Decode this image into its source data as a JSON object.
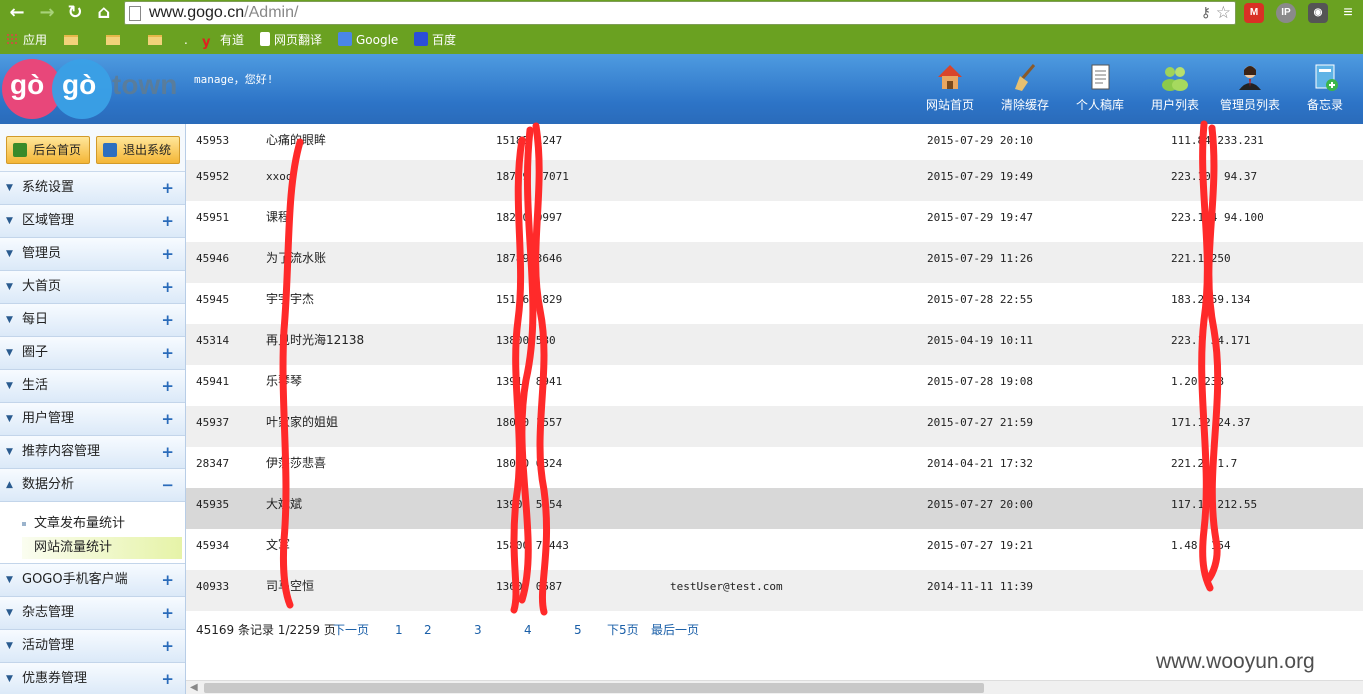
{
  "browser": {
    "url_host": "www.gogo.cn",
    "url_path": "/Admin/",
    "bookmarks": [
      {
        "label": "应用"
      },
      {
        "label": ""
      },
      {
        "label": ""
      },
      {
        "label": ""
      },
      {
        "label": "."
      },
      {
        "label": "有道"
      },
      {
        "label": "网页翻译"
      },
      {
        "label": "Google"
      },
      {
        "label": "百度"
      }
    ],
    "ext_ip": "IP"
  },
  "header": {
    "logo_a": "gò",
    "logo_b": "gò",
    "logo_c": "town",
    "greeting": "manage，您好!",
    "tools": [
      {
        "label": "网站首页"
      },
      {
        "label": "清除缓存"
      },
      {
        "label": "个人稿库"
      },
      {
        "label": "用户列表"
      },
      {
        "label": "管理员列表"
      },
      {
        "label": "备忘录"
      }
    ]
  },
  "sidebar": {
    "home_btn": "后台首页",
    "logout_btn": "退出系统",
    "items": [
      {
        "label": "系统设置",
        "sign": "+"
      },
      {
        "label": "区域管理",
        "sign": "+"
      },
      {
        "label": "管理员",
        "sign": "+"
      },
      {
        "label": "大首页",
        "sign": "+"
      },
      {
        "label": "每日",
        "sign": "+"
      },
      {
        "label": "圈子",
        "sign": "+"
      },
      {
        "label": "生活",
        "sign": "+"
      },
      {
        "label": "用户管理",
        "sign": "+"
      },
      {
        "label": "推荐内容管理",
        "sign": "+"
      },
      {
        "label": "数据分析",
        "sign": "−"
      }
    ],
    "subitems": [
      {
        "label": "文章发布量统计"
      },
      {
        "label": "网站流量统计"
      }
    ],
    "items_after": [
      {
        "label": "GOGO手机客户端",
        "sign": "+"
      },
      {
        "label": "杂志管理",
        "sign": "+"
      },
      {
        "label": "活动管理",
        "sign": "+"
      },
      {
        "label": "优惠券管理",
        "sign": "+"
      }
    ]
  },
  "table": {
    "rows": [
      {
        "id": "45953",
        "name": "心痛的眼眸",
        "phone": "15185 1247",
        "email": "",
        "time": "2015-07-29 20:10",
        "ip": "111.84 233.231"
      },
      {
        "id": "45952",
        "name": "xxoo",
        "phone": "18789 47071",
        "email": "",
        "time": "2015-07-29 19:49",
        "ip": "223.104 94.37"
      },
      {
        "id": "45951",
        "name": "课程",
        "phone": "18280 0997",
        "email": "",
        "time": "2015-07-29 19:47",
        "ip": "223.104 94.100"
      },
      {
        "id": "45946",
        "name": "为了流水账",
        "phone": "18789 3646",
        "email": "",
        "time": "2015-07-29 11:26",
        "ip": "221.1 250"
      },
      {
        "id": "45945",
        "name": "宇宇宇杰",
        "phone": "15136 5829",
        "email": "",
        "time": "2015-07-28 22:55",
        "ip": "183.2 59.134"
      },
      {
        "id": "45314",
        "name": "再见时光海12138",
        "phone": "13800 580",
        "email": "",
        "time": "2015-04-19 10:11",
        "ip": "223.1 34.171"
      },
      {
        "id": "45941",
        "name": "乐琴琴",
        "phone": "13912 8941",
        "email": "",
        "time": "2015-07-28 19:08",
        "ip": "1.20 238"
      },
      {
        "id": "45937",
        "name": "叶家家的姐姐",
        "phone": "18000 1557",
        "email": "",
        "time": "2015-07-27 21:59",
        "ip": "171.12 24.37"
      },
      {
        "id": "28347",
        "name": "伊莎莎悲喜",
        "phone": "18000 0324",
        "email": "",
        "time": "2014-04-21 17:32",
        "ip": "221.2 21.7"
      },
      {
        "id": "45935",
        "name": "大斌斌",
        "phone": "13905 5154",
        "email": "",
        "time": "2015-07-27 20:00",
        "ip": "117.13 212.55"
      },
      {
        "id": "45934",
        "name": "文军",
        "phone": "15800 72443",
        "email": "",
        "time": "2015-07-27 19:21",
        "ip": "1.48. 154"
      },
      {
        "id": "40933",
        "name": "司马空恒",
        "phone": "13600 0587",
        "email": "testUser@test.com",
        "time": "2014-11-11 11:39",
        "ip": ""
      }
    ]
  },
  "pager": {
    "total": "45169 条记录 1/2259 页",
    "next": "下一页",
    "pages": [
      "1",
      "2",
      "3",
      "4",
      "5"
    ],
    "next5": "下5页",
    "last": "最后一页"
  },
  "watermark": "www.wooyun.org",
  "colors": {
    "browser_green": "#6aa121",
    "header_blue": "#2d74c7",
    "sidebar_bg": "#eaf2fb",
    "link_blue": "#1a5fa8",
    "redaction_red": "#ff2a2a"
  }
}
